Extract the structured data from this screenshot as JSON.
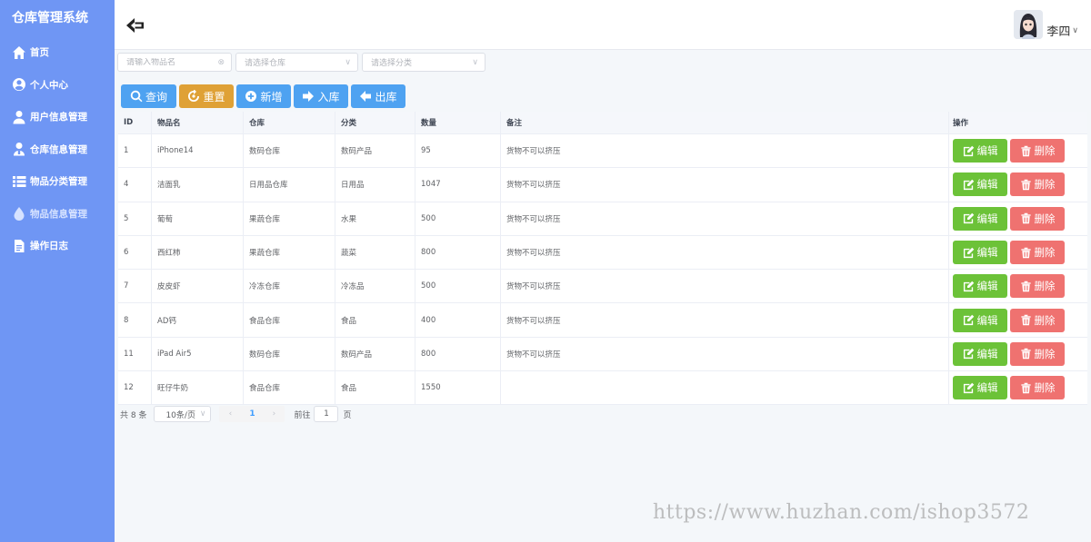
{
  "app_title": "仓库管理系统",
  "sidebar": {
    "items": [
      {
        "label": "首页",
        "icon": "home-icon"
      },
      {
        "label": "个人中心",
        "icon": "user-circle-icon"
      },
      {
        "label": "用户信息管理",
        "icon": "user-icon"
      },
      {
        "label": "仓库信息管理",
        "icon": "warehouse-user-icon"
      },
      {
        "label": "物品分类管理",
        "icon": "list-icon"
      },
      {
        "label": "物品信息管理",
        "icon": "drop-icon",
        "active": true
      },
      {
        "label": "操作日志",
        "icon": "document-icon"
      }
    ]
  },
  "header": {
    "username": "李四"
  },
  "filters": {
    "name_placeholder": "请输入物品名",
    "warehouse_placeholder": "请选择仓库",
    "category_placeholder": "请选择分类"
  },
  "toolbar": {
    "search": "查询",
    "reset": "重置",
    "add": "新增",
    "stock_in": "入库",
    "stock_out": "出库"
  },
  "table": {
    "columns": [
      "ID",
      "物品名",
      "仓库",
      "分类",
      "数量",
      "备注",
      "操作"
    ],
    "edit_label": "编辑",
    "delete_label": "删除",
    "rows": [
      {
        "id": "1",
        "name": "iPhone14",
        "warehouse": "数码仓库",
        "category": "数码产品",
        "count": "95",
        "note": "货物不可以挤压"
      },
      {
        "id": "4",
        "name": "洁面乳",
        "warehouse": "日用品仓库",
        "category": "日用品",
        "count": "1047",
        "note": "货物不可以挤压"
      },
      {
        "id": "5",
        "name": "葡萄",
        "warehouse": "果蔬仓库",
        "category": "水果",
        "count": "500",
        "note": "货物不可以挤压"
      },
      {
        "id": "6",
        "name": "西红柿",
        "warehouse": "果蔬仓库",
        "category": "蔬菜",
        "count": "800",
        "note": "货物不可以挤压"
      },
      {
        "id": "7",
        "name": "皮皮虾",
        "warehouse": "冷冻仓库",
        "category": "冷冻品",
        "count": "500",
        "note": "货物不可以挤压"
      },
      {
        "id": "8",
        "name": "AD钙",
        "warehouse": "食品仓库",
        "category": "食品",
        "count": "400",
        "note": "货物不可以挤压"
      },
      {
        "id": "11",
        "name": "iPad Air5",
        "warehouse": "数码仓库",
        "category": "数码产品",
        "count": "800",
        "note": "货物不可以挤压"
      },
      {
        "id": "12",
        "name": "旺仔牛奶",
        "warehouse": "食品仓库",
        "category": "食品",
        "count": "1550",
        "note": ""
      }
    ]
  },
  "pagination": {
    "total": "共 8 条",
    "page_size": "10条/页",
    "current": "1",
    "goto_label": "前往",
    "goto_value": "1",
    "page_label": "页"
  },
  "watermark": "https://www.huzhan.com/ishop3572"
}
